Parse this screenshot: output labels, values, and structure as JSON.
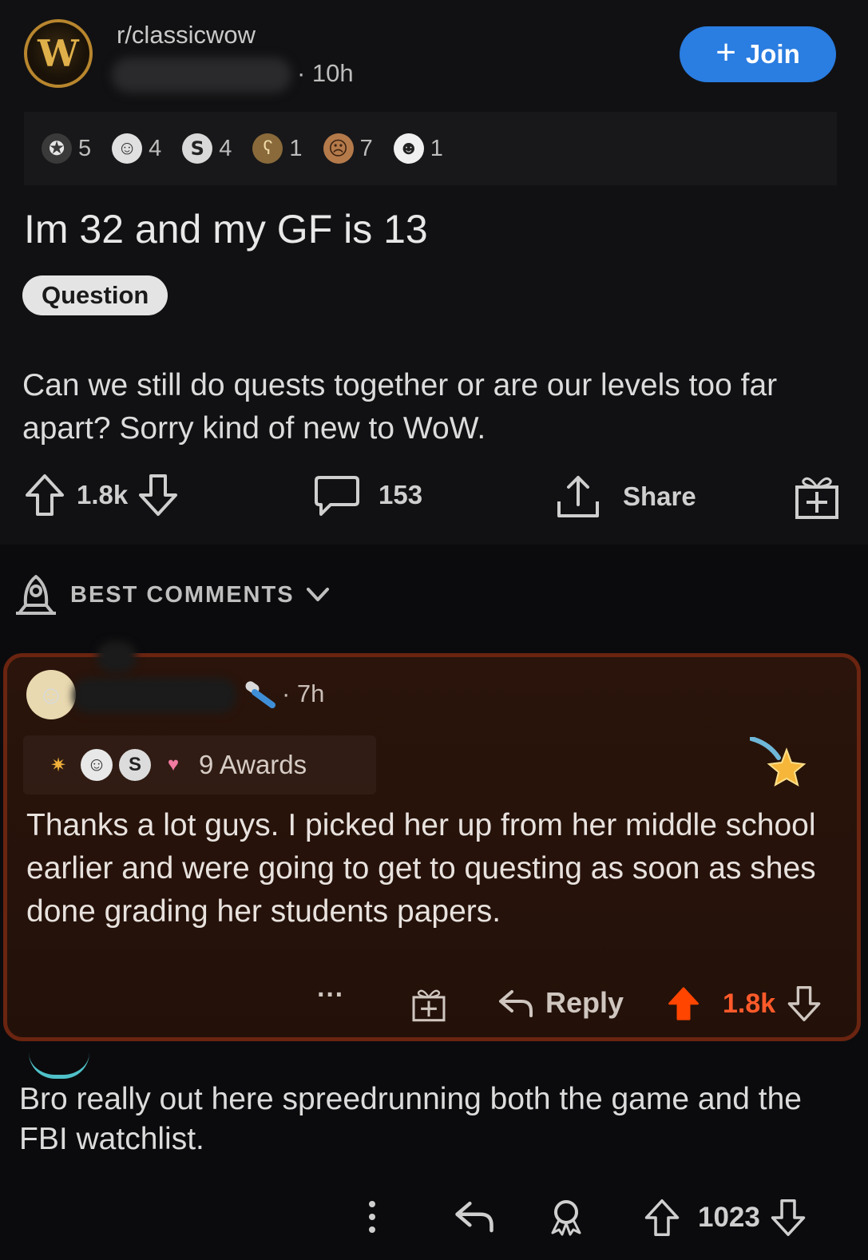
{
  "post": {
    "subreddit": "r/classicwow",
    "subreddit_avatar_letter": "W",
    "time": "· 10h",
    "join_label": "Join",
    "awards": [
      {
        "icon": "gold-award-icon",
        "count": "5"
      },
      {
        "icon": "wholesome-icon",
        "count": "4"
      },
      {
        "icon": "silver-award-icon",
        "count": "4"
      },
      {
        "icon": "bear-award-icon",
        "count": "1"
      },
      {
        "icon": "facepalm-award-icon",
        "count": "7"
      },
      {
        "icon": "snoo-award-icon",
        "count": "1"
      }
    ],
    "title": "Im 32 and my GF is 13",
    "flair": "Question",
    "body": "Can we still do quests together or are our levels too far apart? Sorry kind of new to WoW.",
    "upvotes": "1.8k",
    "comments": "153",
    "share_label": "Share"
  },
  "sort": {
    "label": "BEST COMMENTS"
  },
  "top_comment": {
    "time": "· 7h",
    "awards_label": "9 Awards",
    "body": "Thanks a lot guys. I picked her up from her middle school earlier and were going to get to questing as soon as shes done grading her students papers.",
    "more": "···",
    "reply_label": "Reply",
    "score": "1.8k",
    "colors": {
      "upvote_active": "#ff4500",
      "border": "#6a2410"
    }
  },
  "reply_comment": {
    "body": "Bro really out here spreedrunning both the game and the FBI watchlist.",
    "score": "1023"
  }
}
